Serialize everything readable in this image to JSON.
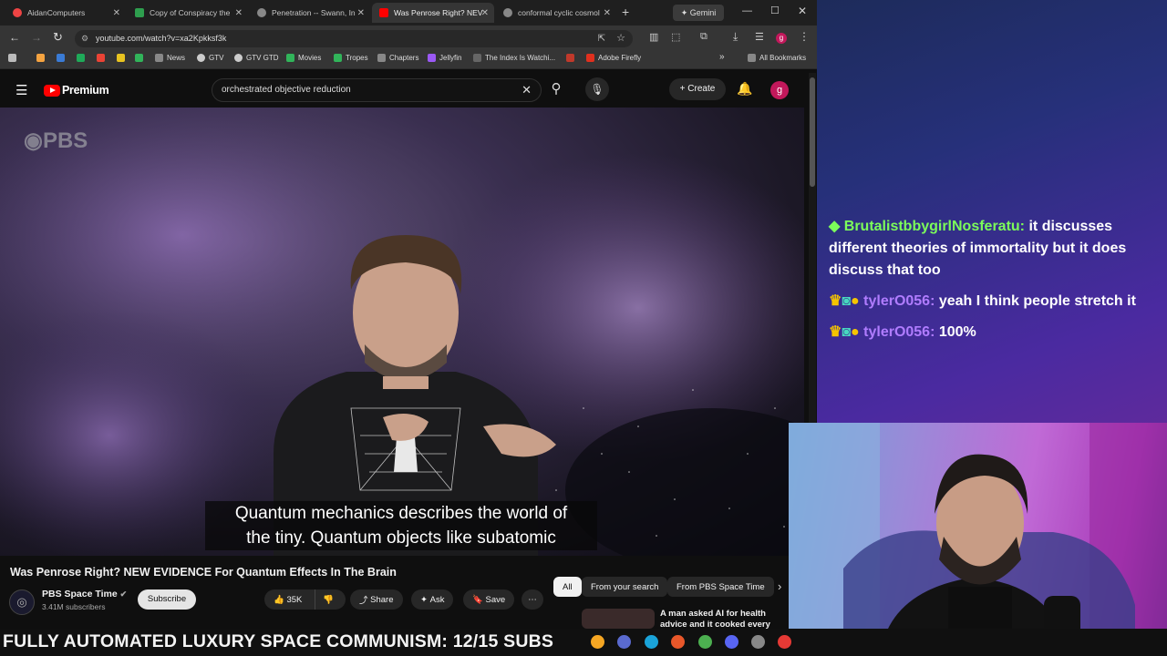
{
  "tabs": [
    {
      "label": "AidanComputers",
      "color": "#e44"
    },
    {
      "label": "Copy of Conspiracy the",
      "color": "#2e9e4e"
    },
    {
      "label": "Penetration -- Swann, In",
      "color": "#888"
    },
    {
      "label": "Was Penrose Right? NEV",
      "color": "#f00"
    },
    {
      "label": "conformal cyclic cosmol",
      "color": "#888"
    }
  ],
  "gemini_label": "Gemini",
  "url": "youtube.com/watch?v=xa2Kpkksf3k",
  "bookmarks": [
    "News",
    "GTV",
    "GTV GTD",
    "Movies",
    "Tropes",
    "Chapters",
    "Jellyfin",
    "The Index Is Watchi...",
    "Adobe Firefly"
  ],
  "all_bookmarks": "All Bookmarks",
  "youtube": {
    "logo": "Premium",
    "search_value": "orchestrated objective reduction",
    "create_label": "Create",
    "avatar_letter": "g",
    "video_watermark": "PBS",
    "caption_line1": "Quantum mechanics describes the world of",
    "caption_line2": "the tiny. Quantum objects like subatomic",
    "video_title": "Was Penrose Right? NEW EVIDENCE For Quantum Effects In The Brain",
    "channel_name": "PBS Space Time",
    "subscribers": "3.41M subscribers",
    "subscribe_label": "Subscribe",
    "likes": "35K",
    "share_label": "Share",
    "ask_label": "Ask",
    "save_label": "Save",
    "chips": [
      "All",
      "From your search",
      "From PBS Space Time"
    ],
    "rec_title": "A man asked AI for health advice and it cooked every bra..."
  },
  "chat": [
    {
      "user": "BrutalistbbygirlNosferatu:",
      "user_color": "#7cfc5a",
      "text": "it discusses different theories of immortality but it does discuss that too"
    },
    {
      "user": "tylerO056:",
      "user_color": "#b07cff",
      "text": "yeah I think people stretch it"
    },
    {
      "user": "tylerO056:",
      "user_color": "#b07cff",
      "text": "100%"
    }
  ],
  "banner": "FULLY AUTOMATED LUXURY SPACE COMMUNISM: 12/15 SUBS"
}
